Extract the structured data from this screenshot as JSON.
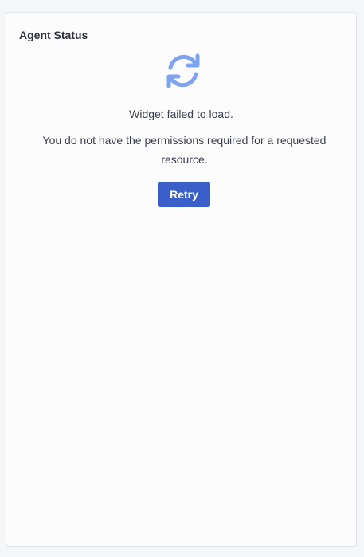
{
  "widget": {
    "title": "Agent Status",
    "icon": "refresh-icon",
    "error_title": "Widget failed to load.",
    "error_message": "You do not have the permissions required for a requested resource.",
    "retry_label": "Retry"
  },
  "colors": {
    "page_background": "#f5f6f8",
    "card_background": "#fcfcfd",
    "icon": "#7ea3f3",
    "retry_button": "#3b5fc9",
    "text": "#3b3f4f"
  }
}
